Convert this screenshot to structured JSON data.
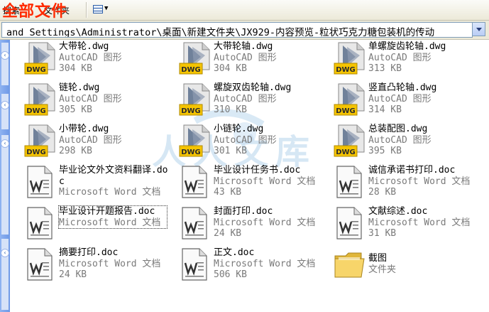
{
  "toolbar": {
    "search_label": "搜索",
    "folders_label": "文件夹",
    "overlay_title": "全部文件"
  },
  "address": {
    "path": "and Settings\\Administrator\\桌面\\新建文件夹\\JX929-内容预览-粒状巧克力糖包装机的传动"
  },
  "files": [
    {
      "name": "大带轮.dwg",
      "type": "AutoCAD 图形",
      "size": "304 KB",
      "icon": "dwg-file-icon"
    },
    {
      "name": "大带轮轴.dwg",
      "type": "AutoCAD 图形",
      "size": "304 KB",
      "icon": "dwg-file-icon"
    },
    {
      "name": "单螺旋齿轮轴.dwg",
      "type": "AutoCAD 图形",
      "size": "313 KB",
      "icon": "dwg-file-icon"
    },
    {
      "name": "链轮.dwg",
      "type": "AutoCAD 图形",
      "size": "305 KB",
      "icon": "dwg-file-icon"
    },
    {
      "name": "螺旋双齿轮轴.dwg",
      "type": "AutoCAD 图形",
      "size": "310 KB",
      "icon": "dwg-file-icon"
    },
    {
      "name": "竖直凸轮轴.dwg",
      "type": "AutoCAD 图形",
      "size": "314 KB",
      "icon": "dwg-file-icon"
    },
    {
      "name": "小带轮.dwg",
      "type": "AutoCAD 图形",
      "size": "298 KB",
      "icon": "dwg-file-icon"
    },
    {
      "name": "小链轮.dwg",
      "type": "AutoCAD 图形",
      "size": "301 KB",
      "icon": "dwg-file-icon"
    },
    {
      "name": "总装配图.dwg",
      "type": "AutoCAD 图形",
      "size": "395 KB",
      "icon": "dwg-file-icon"
    },
    {
      "name": "毕业论文外文资料翻译.doc",
      "type": "Microsoft Word 文档",
      "size": "",
      "icon": "word-doc-icon"
    },
    {
      "name": "毕业设计任务书.doc",
      "type": "Microsoft Word 文档",
      "size": "43 KB",
      "icon": "word-doc-icon"
    },
    {
      "name": "诚信承诺书打印.doc",
      "type": "Microsoft Word 文档",
      "size": "28 KB",
      "icon": "word-doc-icon"
    },
    {
      "name": "毕业设计开题报告.doc",
      "type": "Microsoft Word 文档",
      "size": "",
      "icon": "word-doc-icon"
    },
    {
      "name": "封面打印.doc",
      "type": "Microsoft Word 文档",
      "size": "24 KB",
      "icon": "word-doc-icon"
    },
    {
      "name": "文献综述.doc",
      "type": "Microsoft Word 文档",
      "size": "31 KB",
      "icon": "word-doc-icon"
    },
    {
      "name": "摘要打印.doc",
      "type": "Microsoft Word 文档",
      "size": "24 KB",
      "icon": "word-doc-icon"
    },
    {
      "name": "正文.doc",
      "type": "Microsoft Word 文档",
      "size": "506 KB",
      "icon": "word-doc-icon"
    },
    {
      "name": "截图",
      "type": "文件夹",
      "size": "",
      "icon": "folder-icon"
    }
  ],
  "watermark": {
    "text": "人人文库"
  },
  "colors": {
    "overlay_title": "#ff2a00",
    "dwg_badge": "#f5c400",
    "folder": "#f2c94c",
    "meta_text": "#7a7a7a"
  }
}
